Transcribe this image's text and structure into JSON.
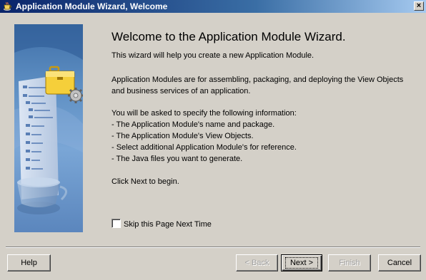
{
  "window": {
    "title": "Application Module Wizard, Welcome",
    "close_glyph": "×",
    "icon": "coffee-cup-icon"
  },
  "main": {
    "heading": "Welcome to the Application Module Wizard.",
    "intro": "This wizard will help you create a new Application Module.",
    "description_line1": "Application Modules are for assembling, packaging, and deploying the View Objects",
    "description_line2": "and business services of an application.",
    "list_intro": "You will be asked to specify the following information:",
    "list_items": [
      "- The Application Module's name and package.",
      "- The Application Module's View Objects.",
      "- Select additional Application Module's for reference.",
      "- The Java files you want to generate."
    ],
    "closing": "Click Next to begin.",
    "skip_label": "Skip this Page Next Time",
    "skip_checked": false
  },
  "side_image": {
    "icon": "briefcase-gear-icon"
  },
  "footer": {
    "help_label": "Help",
    "back_label": "< Back",
    "next_label": "Next >",
    "finish_label": "Finish",
    "cancel_label": "Cancel"
  }
}
